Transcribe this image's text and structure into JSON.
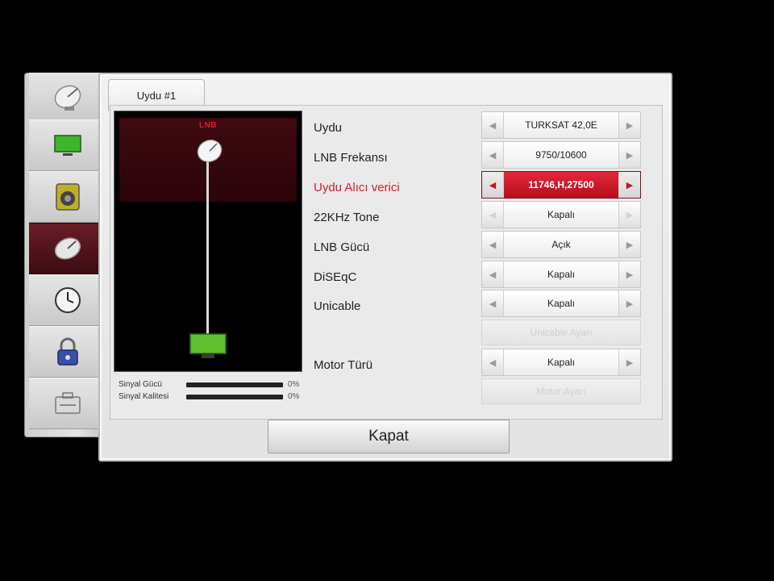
{
  "tab": {
    "label": "Uydu #1"
  },
  "preview": {
    "lnb_label": "LNB"
  },
  "meters": [
    {
      "label": "Sinyal Gücü",
      "value": "0%"
    },
    {
      "label": "Sinyal Kalitesi",
      "value": "0%"
    }
  ],
  "settings": [
    {
      "label": "Uydu",
      "value": "TURKSAT 42,0E"
    },
    {
      "label": "LNB Frekansı",
      "value": "9750/10600"
    },
    {
      "label": "Uydu Alıcı verici",
      "value": "11746,H,27500"
    },
    {
      "label": "22KHz Tone",
      "value": "Kapalı"
    },
    {
      "label": "LNB Gücü",
      "value": "Açık"
    },
    {
      "label": "DiSEqC",
      "value": "Kapalı"
    },
    {
      "label": "Unicable",
      "value": "Kapalı"
    },
    {
      "label": "Motor Türü",
      "value": "Kapalı"
    }
  ],
  "buttons": {
    "unicable_settings": "Unicable Ayarı",
    "motor_settings": "Motor Ayarı",
    "close": "Kapat"
  },
  "colors": {
    "accent": "#d4202f",
    "active_value_bg": "#d61f32"
  },
  "icons": {
    "arrow_left": "◀",
    "arrow_right": "▶"
  }
}
